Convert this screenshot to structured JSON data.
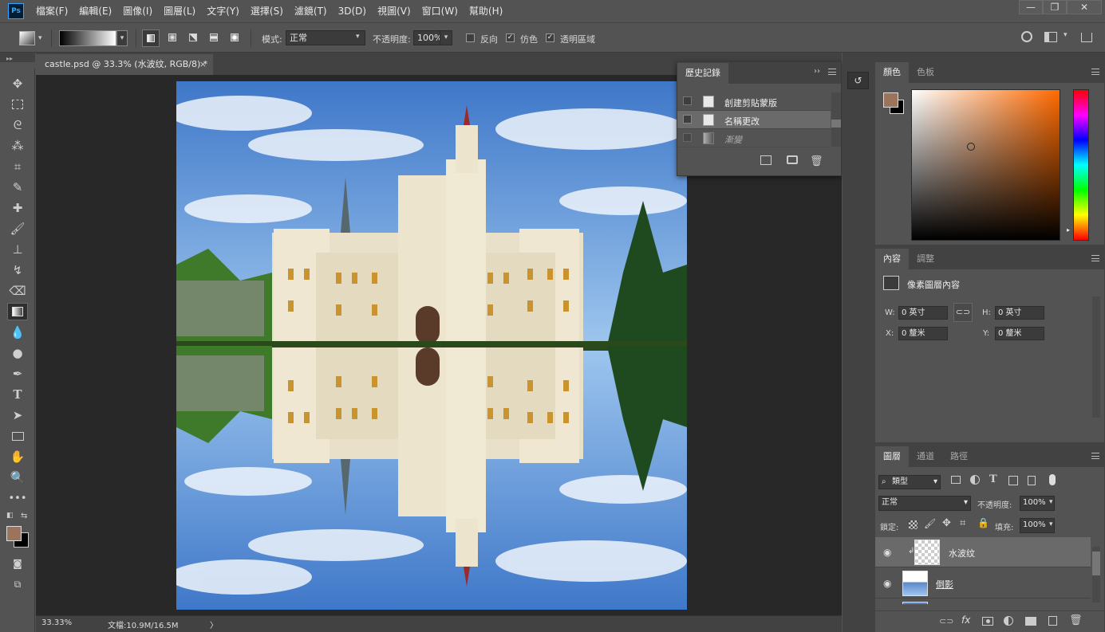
{
  "menubar": {
    "logo": "Ps",
    "items": [
      "檔案(F)",
      "編輯(E)",
      "圖像(I)",
      "圖層(L)",
      "文字(Y)",
      "選擇(S)",
      "濾鏡(T)",
      "3D(D)",
      "視圖(V)",
      "窗口(W)",
      "幫助(H)"
    ],
    "window_buttons": [
      "—",
      "❐",
      "✕"
    ]
  },
  "options": {
    "mode_label": "模式:",
    "mode_value": "正常",
    "opacity_label": "不透明度:",
    "opacity_value": "100%",
    "reverse_label": "反向",
    "dither_label": "仿色",
    "transparency_label": "透明區域",
    "reverse_checked": false,
    "dither_checked": true,
    "transparency_checked": true
  },
  "document": {
    "tab_title": "castle.psd @ 33.3% (水波纹, RGB/8) *",
    "tab_close": "×",
    "zoom": "33.33%",
    "doc_info": "文檔:10.9M/16.5M",
    "status_arrow": "〉"
  },
  "history": {
    "title": "歷史記錄",
    "items": [
      {
        "label": "創建剪貼蒙版",
        "icon": "document-icon"
      },
      {
        "label": "名稱更改",
        "icon": "document-icon"
      },
      {
        "label": "漸變",
        "icon": "gradient-icon"
      }
    ]
  },
  "color_panel": {
    "tabs": [
      "顏色",
      "色板"
    ],
    "foreground": "#9c735b",
    "background": "#000000",
    "hue_color": "#ff6a00"
  },
  "properties": {
    "tabs": [
      "內容",
      "調整"
    ],
    "subtitle": "像素圖層內容",
    "w_label": "W:",
    "w_value": "0 英寸",
    "h_label": "H:",
    "h_value": "0 英寸",
    "x_label": "X:",
    "x_value": "0 釐米",
    "y_label": "Y:",
    "y_value": "0 釐米"
  },
  "layers": {
    "tabs": [
      "圖層",
      "通道",
      "路徑"
    ],
    "filter_type": "類型",
    "blend_mode": "正常",
    "opacity_label": "不透明度:",
    "opacity_value": "100%",
    "lock_label": "鎖定:",
    "fill_label": "填充:",
    "fill_value": "100%",
    "items": [
      {
        "name": "水波纹",
        "selected": true,
        "clipped": true
      },
      {
        "name": "倒影",
        "selected": false,
        "clipped": false
      }
    ]
  },
  "colors": {
    "app_bg": "#535353",
    "panel_dark": "#424242",
    "canvas_bg": "#282828",
    "accent": "#31a8ff"
  }
}
